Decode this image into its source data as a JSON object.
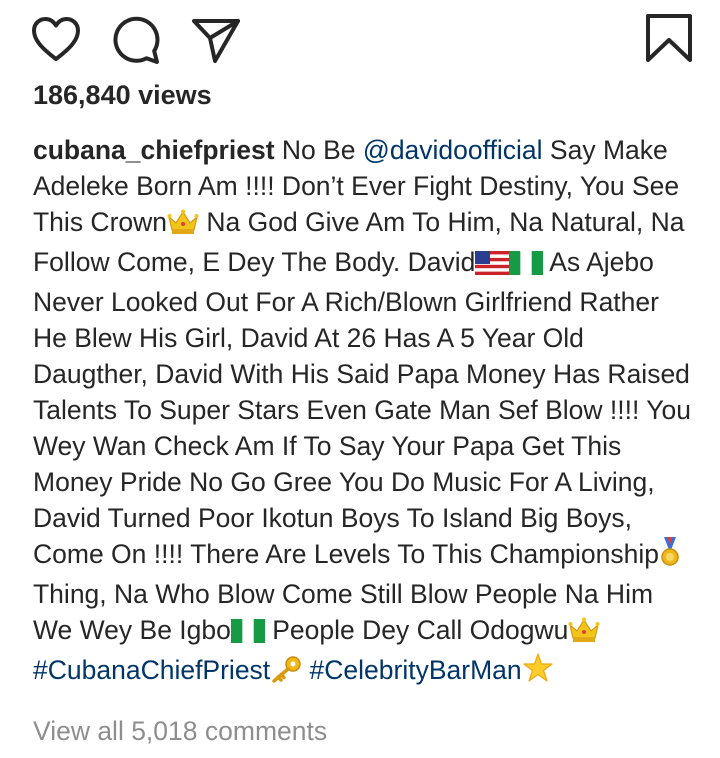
{
  "actions": {
    "like": "heart-icon",
    "comment": "comment-bubble-icon",
    "share": "paper-plane-icon",
    "save": "bookmark-icon"
  },
  "post": {
    "views": "186,840 views",
    "username": "cubana_chiefpriest",
    "caption": {
      "p1": " No Be ",
      "mention": "@davidoofficial",
      "p2": " Say Make Adeleke Born Am !!!! Don’t Ever Fight Destiny, You See This Crown",
      "p3": " Na God Give Am To Him, Na Natural, Na Follow Come, E Dey The Body. David",
      "p4": " As Ajebo Never Looked Out For A Rich/Blown Girlfriend Rather He Blew His Girl, David At 26 Has A 5 Year Old Daugther, David With His Said Papa Money Has Raised Talents To Super Stars Even Gate Man Sef Blow !!!! You Wey Wan Check Am If To Say Your Papa Get This Money Pride No Go Gree You Do Music For A Living, David Turned Poor Ikotun Boys To Island Big Boys, Come On !!!! There Are Levels To This Championship",
      "p5": " Thing, Na Who Blow Come Still Blow People Na Him We Wey Be Igbo",
      "p6": " People Dey Call Odogwu",
      "hashtag1": "#CubanaChiefPriest",
      "hashtag2": "#CelebrityBarMan"
    },
    "view_all_comments": "View all 5,018 comments"
  },
  "colors": {
    "text": "#262626",
    "link": "#003569",
    "muted": "#8e8e8e"
  }
}
